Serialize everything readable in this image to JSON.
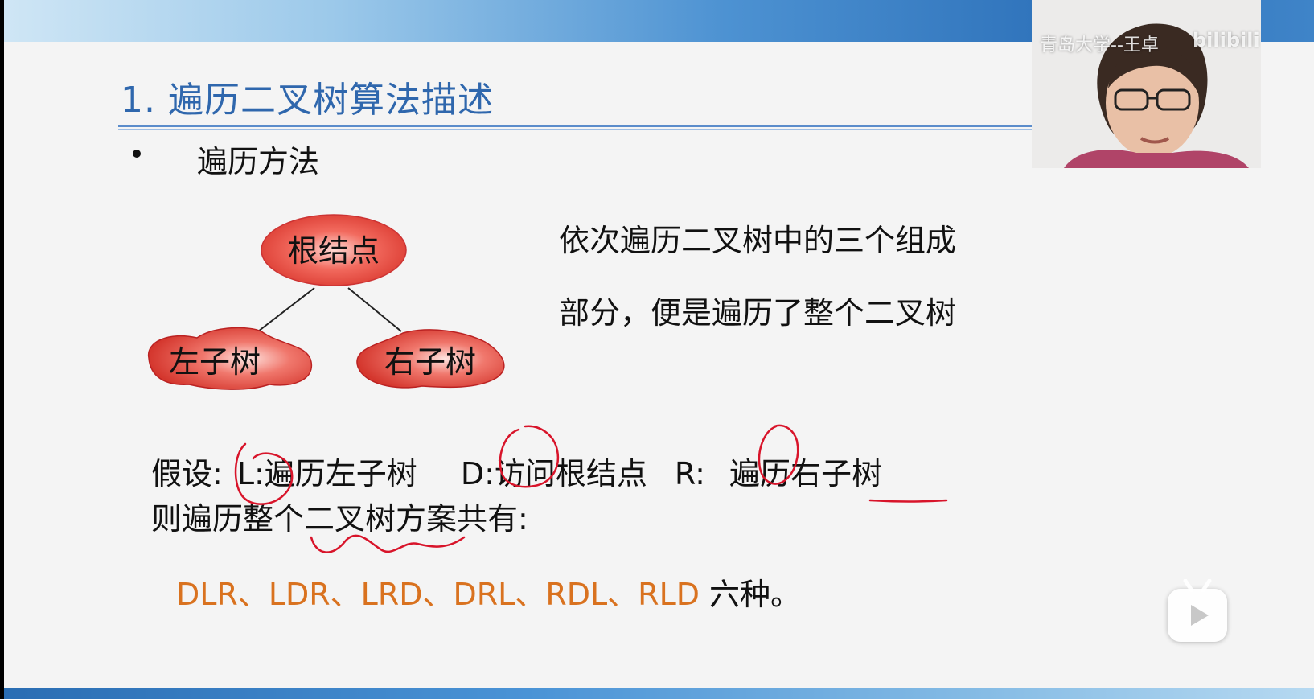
{
  "slide": {
    "title": "1. 遍历二叉树算法描述",
    "bullet": "遍历方法",
    "diagram": {
      "root": "根结点",
      "left": "左子树",
      "right": "右子树"
    },
    "description": [
      "依次遍历二叉树中的三个组成",
      "部分，便是遍历了整个二叉树"
    ],
    "assume": {
      "prefix": "假设:",
      "L_key": "L:",
      "L_text": "遍历左子树",
      "D_key": "D:",
      "D_text": "访问根结点",
      "R_key": "R:",
      "R_text": "遍历右子树"
    },
    "scheme_line": "则遍历整个二叉树方案共有:",
    "orders": "DLR、LDR、LRD、DRL、RDL、RLD",
    "orders_suffix": "六种。"
  },
  "webcam": {
    "label": "青岛大学--王卓",
    "watermark": "bilibili"
  },
  "colors": {
    "title": "#2f67ad",
    "accent_orange": "#d9721f",
    "annotation_red": "#d8142a",
    "node_red": "#e2423c"
  },
  "icons": {
    "play": "play-icon"
  }
}
